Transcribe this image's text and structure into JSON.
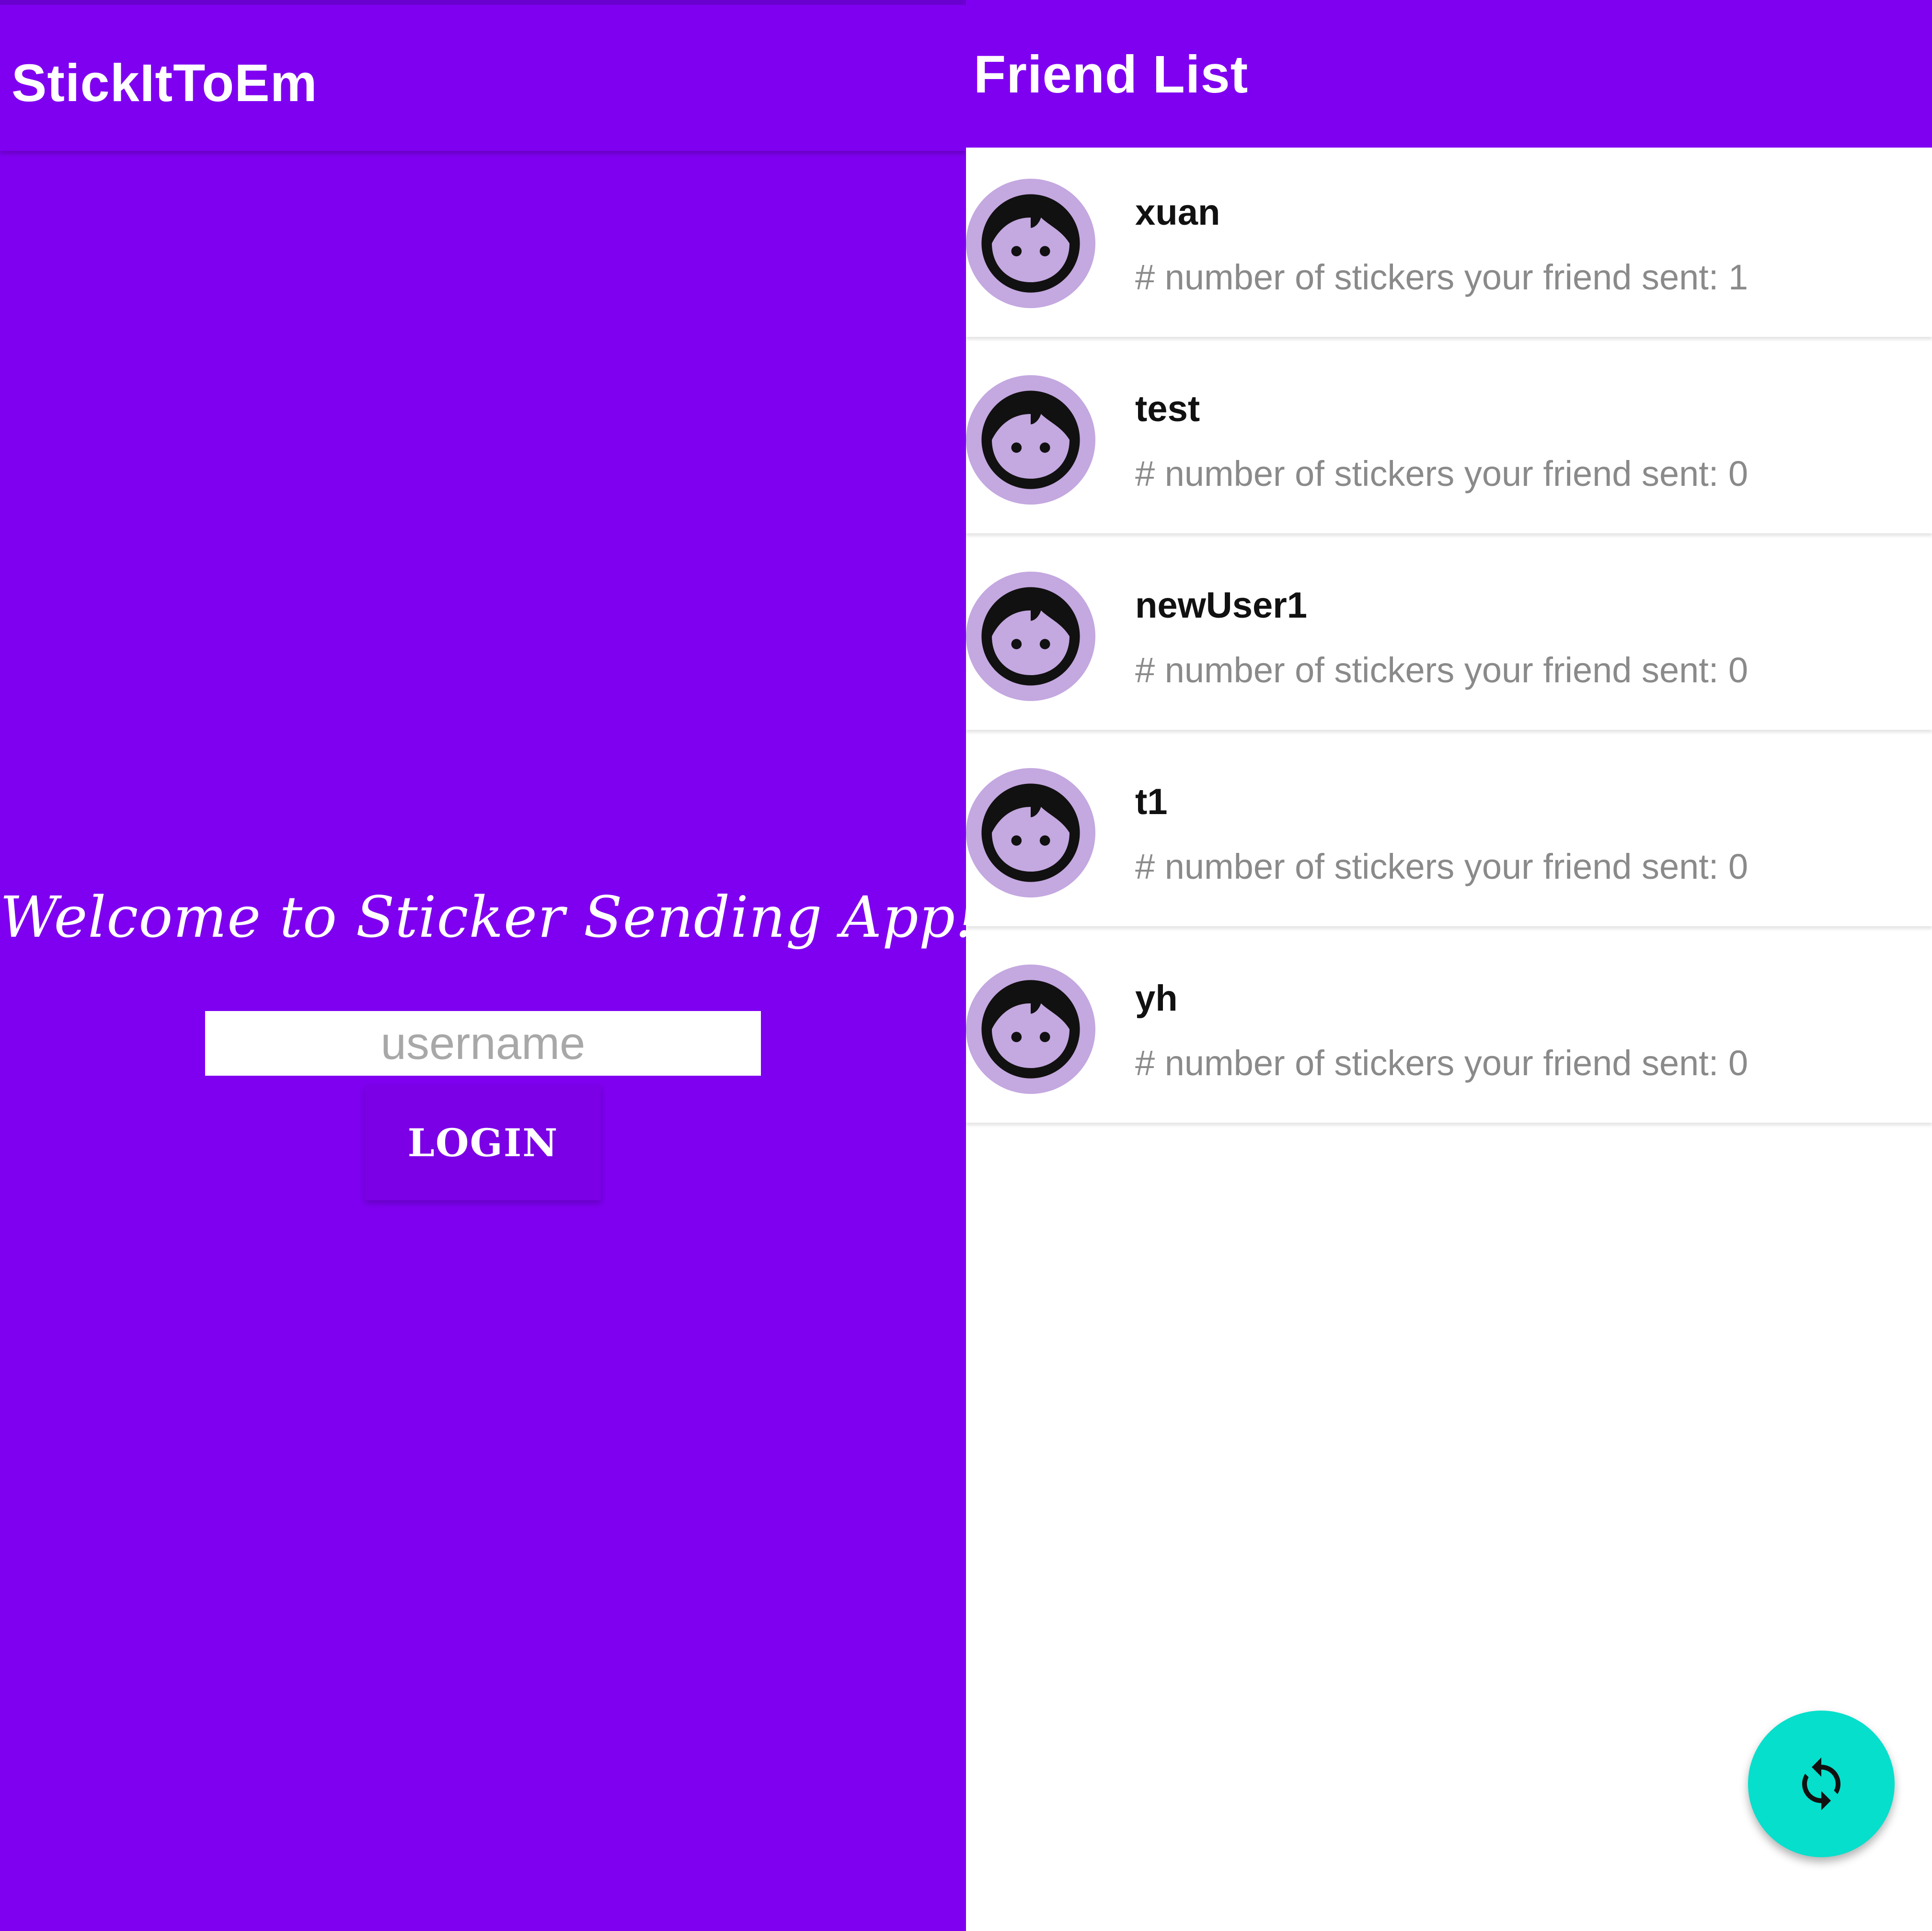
{
  "login_screen": {
    "app_title": "StickItToEm",
    "welcome_text": "Welcome to Sticker Sending App!",
    "username_placeholder": "username",
    "username_value": "",
    "login_button_label": "LOGIN"
  },
  "friend_list_screen": {
    "title": "Friend List",
    "friends": [
      {
        "name": "xuan",
        "sticker_count_label": "# number of stickers your friend sent: 1"
      },
      {
        "name": "test",
        "sticker_count_label": "# number of stickers your friend sent: 0"
      },
      {
        "name": "newUser1",
        "sticker_count_label": "# number of stickers your friend sent: 0"
      },
      {
        "name": "t1",
        "sticker_count_label": "# number of stickers your friend sent: 0"
      },
      {
        "name": "yh",
        "sticker_count_label": "# number of stickers your friend sent: 0"
      }
    ],
    "avatar_icon": "face-icon",
    "fab_icon": "refresh-icon"
  },
  "colors": {
    "primary": "#7f00f0",
    "avatar_bg": "#c4a8e0",
    "fab": "#05dfcc",
    "secondary_text": "#8a8a8a"
  }
}
